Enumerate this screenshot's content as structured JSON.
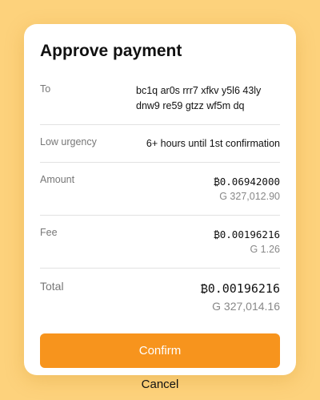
{
  "title": "Approve payment",
  "to": {
    "label": "To",
    "address": "bc1q ar0s rrr7 xfkv y5l6 43ly dnw9 re59 gtzz wf5m dq"
  },
  "urgency": {
    "label": "Low urgency",
    "value": "6+ hours until 1st confirmation"
  },
  "amount": {
    "label": "Amount",
    "btc": "₿0.06942000",
    "fiat": "G 327,012.90"
  },
  "fee": {
    "label": "Fee",
    "btc": "₿0.00196216",
    "fiat": "G 1.26"
  },
  "total": {
    "label": "Total",
    "btc": "₿0.00196216",
    "fiat": "G 327,014.16"
  },
  "buttons": {
    "confirm": "Confirm",
    "cancel": "Cancel"
  }
}
